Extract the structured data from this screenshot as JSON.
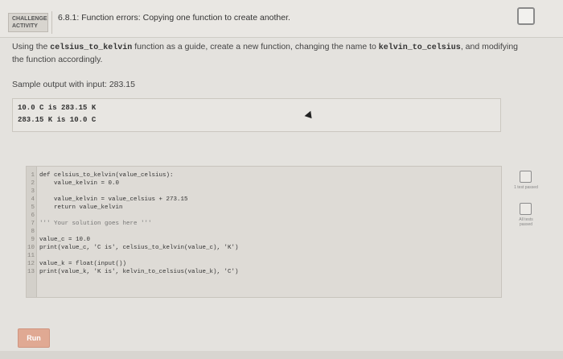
{
  "header": {
    "badge": "CHALLENGE ACTIVITY",
    "title": "6.8.1: Function errors: Copying one function to create another."
  },
  "description": {
    "part1": "Using the ",
    "code1": "celsius_to_kelvin",
    "part2": " function as a guide, create a new function, changing the name to ",
    "code2": "kelvin_to_celsius",
    "part3": ", and modifying the function accordingly."
  },
  "sample": {
    "label": "Sample output with input: 283.15",
    "lines": [
      "10.0 C is 283.15 K",
      "283.15 K is 10.0 C"
    ]
  },
  "editor": {
    "lines": [
      {
        "n": "1",
        "text": "def celsius_to_kelvin(value_celsius):"
      },
      {
        "n": "2",
        "text": "    value_kelvin = 0.0"
      },
      {
        "n": "3",
        "text": ""
      },
      {
        "n": "4",
        "text": "    value_kelvin = value_celsius + 273.15"
      },
      {
        "n": "5",
        "text": "    return value_kelvin"
      },
      {
        "n": "6",
        "text": ""
      },
      {
        "n": "7",
        "text": "''' Your solution goes here '''"
      },
      {
        "n": "8",
        "text": ""
      },
      {
        "n": "9",
        "text": "value_c = 10.0"
      },
      {
        "n": "10",
        "text": "print(value_c, 'C is', celsius_to_kelvin(value_c), 'K')"
      },
      {
        "n": "11",
        "text": ""
      },
      {
        "n": "12",
        "text": "value_k = float(input())"
      },
      {
        "n": "13",
        "text": "print(value_k, 'K is', kelvin_to_celsius(value_k), 'C')"
      }
    ]
  },
  "tests": {
    "test1_label": "1 test passed",
    "all_label": "All tests passed"
  },
  "run_label": "Run"
}
